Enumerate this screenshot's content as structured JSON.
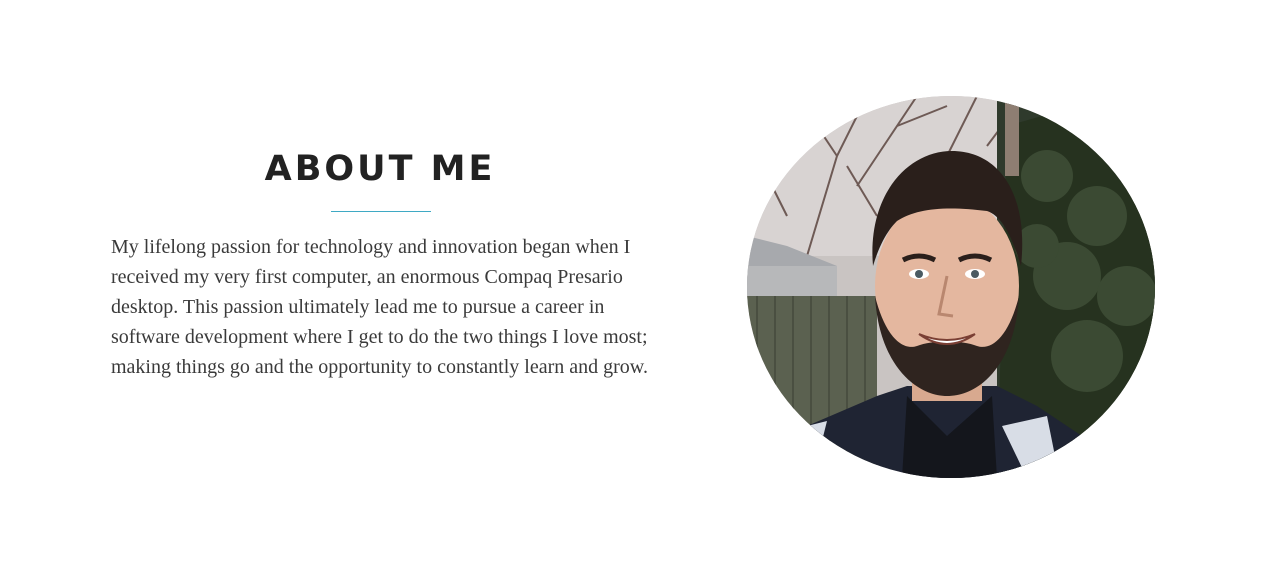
{
  "about": {
    "heading": "ABOUT ME",
    "bio": "My lifelong passion for technology and innovation began when I received my very first computer, an enormous Compaq Presario desktop. This passion ultimately lead me to pursue a career in software development where I get to do the two things I love most; making things go and the opportunity to constantly learn and grow.",
    "accent_color": "#3fa9c4"
  },
  "profile_photo": {
    "alt": "profile photo"
  }
}
